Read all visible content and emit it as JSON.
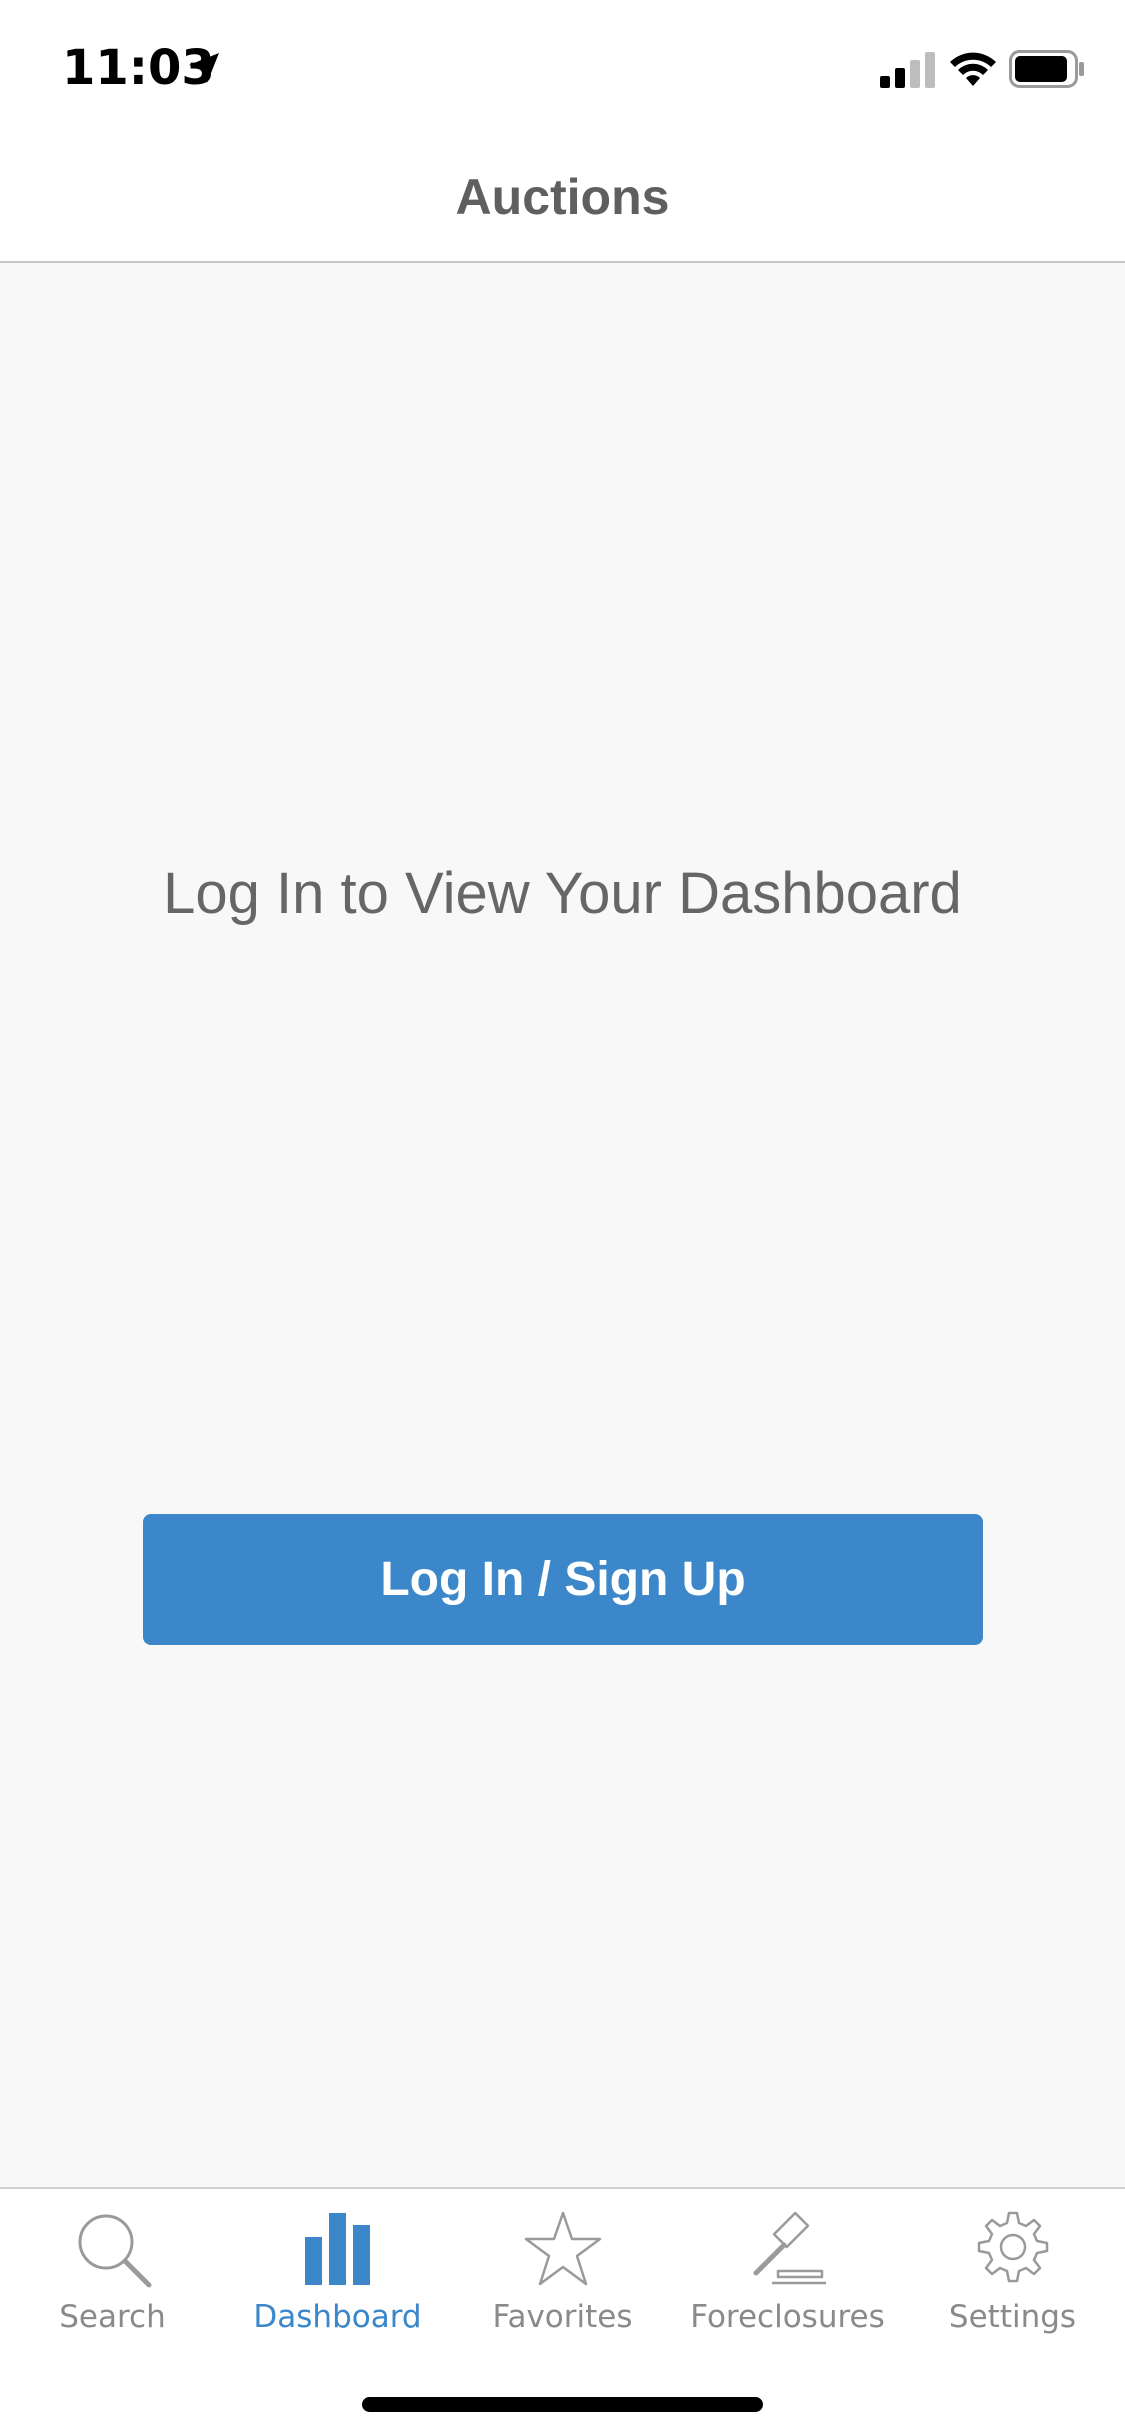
{
  "status_bar": {
    "time": "11:03",
    "location_icon": "location-arrow-icon",
    "signal_icon": "cellular-signal-icon",
    "wifi_icon": "wifi-icon",
    "battery_icon": "battery-icon"
  },
  "nav": {
    "title": "Auctions"
  },
  "main": {
    "prompt": "Log In to View Your Dashboard",
    "login_button_label": "Log In / Sign Up"
  },
  "tabs": [
    {
      "label": "Search",
      "icon": "search-icon",
      "active": false
    },
    {
      "label": "Dashboard",
      "icon": "bar-chart-icon",
      "active": true
    },
    {
      "label": "Favorites",
      "icon": "star-icon",
      "active": false
    },
    {
      "label": "Foreclosures",
      "icon": "gavel-icon",
      "active": false
    },
    {
      "label": "Settings",
      "icon": "gear-icon",
      "active": false
    }
  ],
  "colors": {
    "accent": "#3b87c9",
    "inactive_tab": "#8a8a8a",
    "title": "#5d605f",
    "background": "#f8f8f8"
  }
}
